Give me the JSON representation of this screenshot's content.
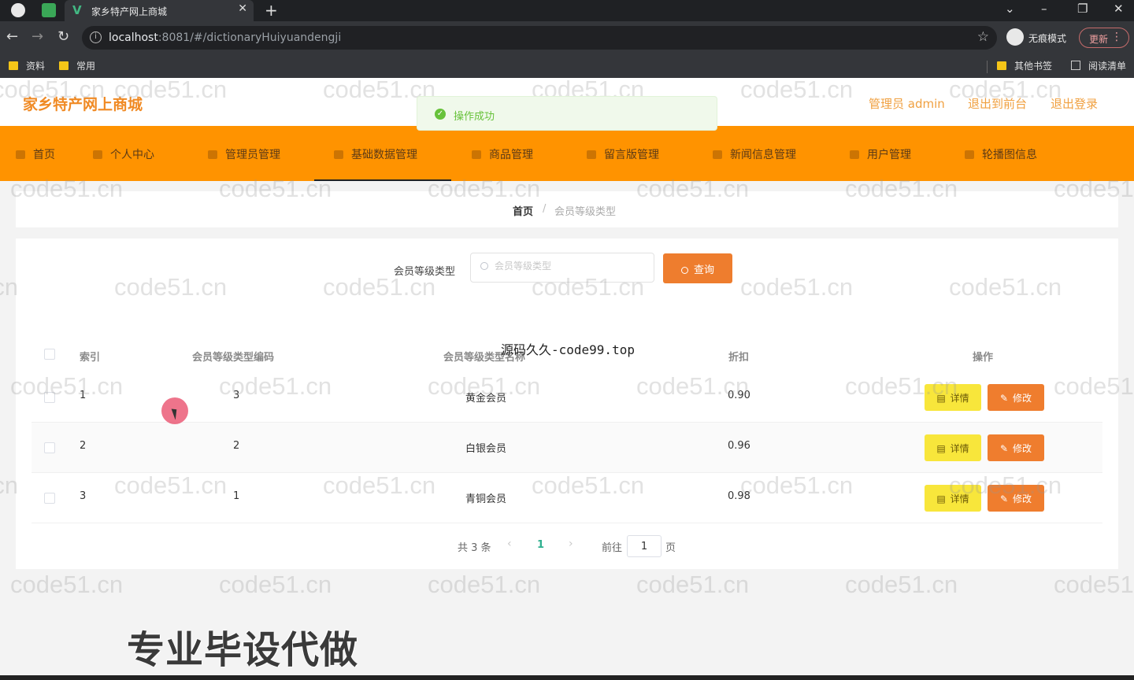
{
  "browser": {
    "tab_title": "家乡特产网上商城",
    "tab_favicon": "V",
    "new_tab_symbol": "+",
    "close_symbol": "✕",
    "url_host": "localhost",
    "url_rest": ":8081/#/dictionaryHuiyuandengji",
    "incognito_label": "无痕模式",
    "update_label": "更新",
    "bookmarks": [
      "资料",
      "常用"
    ],
    "bookmarks_right": [
      "其他书签",
      "阅读清单"
    ]
  },
  "header": {
    "site_title": "家乡特产网上商城",
    "user_label": "管理员 admin",
    "back_to_front": "退出到前台",
    "logout": "退出登录",
    "accent_color": "#ff9300"
  },
  "toast": {
    "text": "操作成功",
    "status": "success"
  },
  "nav": {
    "items": [
      {
        "label": "首页",
        "icon": "home-icon"
      },
      {
        "label": "个人中心",
        "icon": "user-icon"
      },
      {
        "label": "管理员管理",
        "icon": "admin-icon"
      },
      {
        "label": "基础数据管理",
        "icon": "data-icon"
      },
      {
        "label": "商品管理",
        "icon": "goods-icon"
      },
      {
        "label": "留言版管理",
        "icon": "message-icon"
      },
      {
        "label": "新闻信息管理",
        "icon": "news-icon"
      },
      {
        "label": "用户管理",
        "icon": "users-icon"
      },
      {
        "label": "轮播图信息",
        "icon": "carousel-icon"
      }
    ],
    "active": "基础数据管理"
  },
  "breadcrumb": {
    "home": "首页",
    "separator": "/",
    "current": "会员等级类型"
  },
  "search": {
    "label": "会员等级类型",
    "placeholder": "会员等级类型",
    "value": "",
    "button_label": "查询"
  },
  "table": {
    "columns": [
      "索引",
      "会员等级类型编码",
      "会员等级类型名称",
      "折扣",
      "操作"
    ],
    "rows": [
      {
        "index": "1",
        "code": "3",
        "name": "黄金会员",
        "discount": "0.90"
      },
      {
        "index": "2",
        "code": "2",
        "name": "白银会员",
        "discount": "0.96"
      },
      {
        "index": "3",
        "code": "1",
        "name": "青铜会员",
        "discount": "0.98"
      }
    ],
    "detail_label": "详情",
    "edit_label": "修改"
  },
  "pagination": {
    "total_text": "共 3 条",
    "current_page": "1",
    "goto_label": "前往",
    "goto_value": "1",
    "page_suffix": "页",
    "prev_symbol": "‹",
    "next_symbol": "›"
  },
  "overlays": {
    "source_text": "源码久久-code99.top",
    "promo_text": "专业毕设代做",
    "watermark": "code51.cn"
  }
}
